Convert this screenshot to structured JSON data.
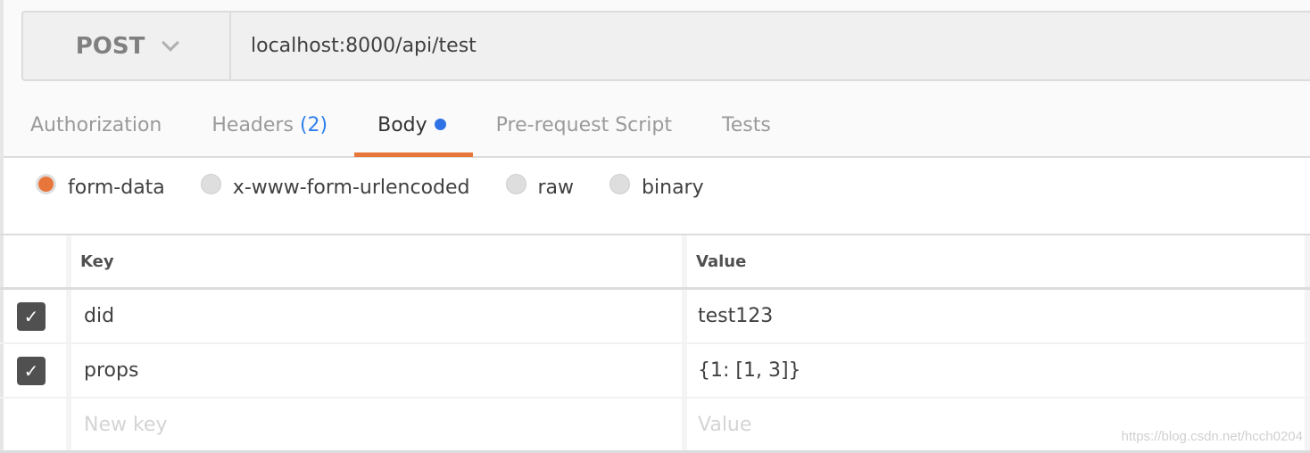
{
  "request": {
    "method": "POST",
    "url": "localhost:8000/api/test"
  },
  "tabs": [
    {
      "label": "Authorization"
    },
    {
      "label": "Headers",
      "count": "(2)"
    },
    {
      "label": "Body",
      "active": true
    },
    {
      "label": "Pre-request Script"
    },
    {
      "label": "Tests"
    }
  ],
  "body_types": [
    {
      "label": "form-data",
      "selected": true
    },
    {
      "label": "x-www-form-urlencoded"
    },
    {
      "label": "raw"
    },
    {
      "label": "binary"
    }
  ],
  "table": {
    "headers": {
      "key": "Key",
      "value": "Value"
    },
    "rows": [
      {
        "checked": true,
        "key": "did",
        "value": "test123"
      },
      {
        "checked": true,
        "key": "props",
        "value": "{1: [1, 3]}"
      }
    ],
    "new_row": {
      "key_placeholder": "New key",
      "value_placeholder": "Value"
    }
  },
  "watermark": "https://blog.csdn.net/hcch0204",
  "colors": {
    "accent": "#e8763a",
    "badge": "#2f80ed"
  }
}
